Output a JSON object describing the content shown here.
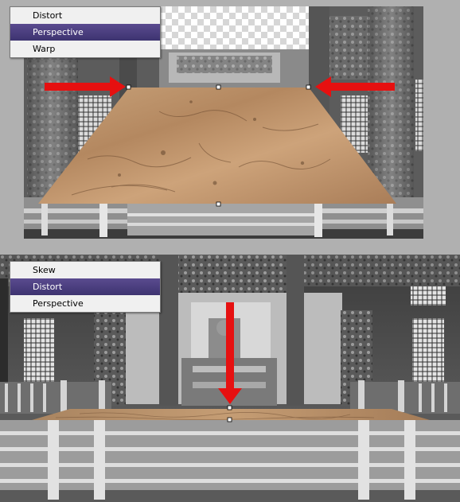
{
  "menus": {
    "top": {
      "items": [
        {
          "label": "Distort"
        },
        {
          "label": "Perspective",
          "selected": true
        },
        {
          "label": "Warp"
        }
      ]
    },
    "bottom": {
      "items": [
        {
          "label": "Skew"
        },
        {
          "label": "Distort",
          "selected": true
        },
        {
          "label": "Perspective"
        }
      ]
    }
  },
  "colors": {
    "menu_bg": "#f0f0f0",
    "menu_highlight": "#463a7c",
    "arrow": "#e61010",
    "marble": "#c49a70",
    "canvas_bg": "#b0b0b0"
  },
  "icons": {
    "arrow_top_left": "arrow-right-icon",
    "arrow_top_right": "arrow-left-icon",
    "arrow_bottom": "arrow-down-icon"
  }
}
